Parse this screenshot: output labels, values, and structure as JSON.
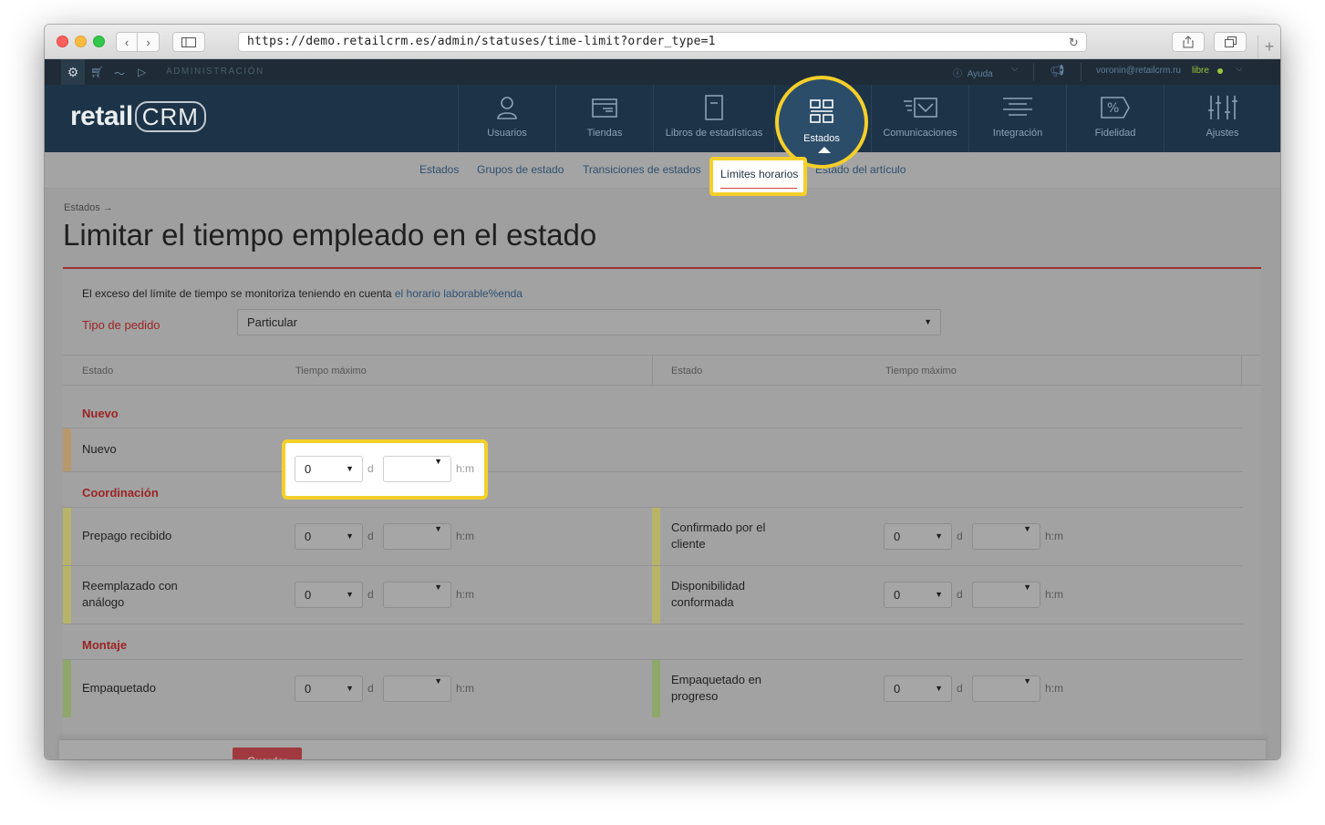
{
  "browser": {
    "url": "https://demo.retailcrm.es/admin/statuses/time-limit?order_type=1",
    "icons": [
      "back-icon",
      "forward-icon",
      "sidebar-icon",
      "reload-icon",
      "share-icon",
      "tabs-icon",
      "new-tab-icon"
    ]
  },
  "admin_bar": {
    "section_label": "ADMINISTRACIÓN",
    "help_label": "Ayuda",
    "user_email": "voronin@retailcrm.ru",
    "user_status": "libre",
    "status_color": "#9bc53d"
  },
  "logo": {
    "text_a": "retail",
    "text_b": "CRM"
  },
  "main_nav": {
    "items": [
      {
        "label": "Usuarios",
        "icon": "user-icon"
      },
      {
        "label": "Tiendas",
        "icon": "store-icon"
      },
      {
        "label": "Libros de estadísticas",
        "icon": "book-icon"
      },
      {
        "label": "Estados",
        "icon": "statuses-grid-icon",
        "active": true
      },
      {
        "label": "Comunicaciones",
        "icon": "mail-icon"
      },
      {
        "label": "Integración",
        "icon": "integration-icon"
      },
      {
        "label": "Fidelidad",
        "icon": "percent-tag-icon"
      },
      {
        "label": "Ajustes",
        "icon": "sliders-icon"
      }
    ]
  },
  "subnav": {
    "items": [
      "Estados",
      "Grupos de estado",
      "Transiciones de estados",
      "Límites horarios",
      "Estado del artículo"
    ],
    "active": "Límites horarios"
  },
  "page": {
    "breadcrumb": "Estados →",
    "title": "Limitar el tiempo empleado en el estado",
    "info_text": "El exceso del límite de tiempo se monitoriza teniendo en cuenta",
    "info_link": "el horario laborable%enda",
    "order_type_label": "Tipo de pedido",
    "order_type_value": "Particular"
  },
  "table": {
    "headers": [
      "Estado",
      "Tiempo máximo",
      "Estado",
      "Tiempo máximo"
    ],
    "unit_days": "d",
    "unit_hm": "h:m",
    "groups": [
      {
        "title": "Nuevo",
        "rows": [
          [
            {
              "name": "Nuevo",
              "days": "0",
              "hm": "",
              "color": "#b79a6c"
            }
          ]
        ]
      },
      {
        "title": "Coordinación",
        "rows": [
          [
            {
              "name": "Prepago recibido",
              "days": "0",
              "hm": "",
              "color": "#b7b46a"
            },
            {
              "name": "Confirmado por el cliente",
              "days": "0",
              "hm": "",
              "color": "#b7b46a"
            }
          ],
          [
            {
              "name": "Reemplazado con análogo",
              "days": "0",
              "hm": "",
              "color": "#b7b46a"
            },
            {
              "name": "Disponibilidad conformada",
              "days": "0",
              "hm": "",
              "color": "#b7b46a"
            }
          ]
        ]
      },
      {
        "title": "Montaje",
        "rows": [
          [
            {
              "name": "Empaquetado",
              "days": "0",
              "hm": "",
              "color": "#8fa76a"
            },
            {
              "name": "Empaquetado en progreso",
              "days": "0",
              "hm": "",
              "color": "#8fa76a"
            }
          ]
        ]
      }
    ]
  },
  "footer": {
    "save_label": "Guardar",
    "save_color": "#c9474f"
  },
  "highlight_color": "#f5cf2a"
}
